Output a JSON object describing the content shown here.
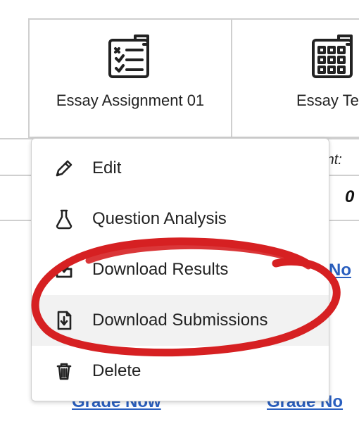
{
  "columns": [
    {
      "title": "Essay Assignment 01",
      "icon": "checklist-icon"
    },
    {
      "title": "Essay Test",
      "icon": "grid-sheet-icon"
    }
  ],
  "row_info": {
    "points_fragment": "oint:",
    "zero_value": "0"
  },
  "links": {
    "partial_right": "e No",
    "bottom_left": "Grade Now",
    "bottom_right": "Grade No"
  },
  "menu": {
    "items": [
      {
        "id": "edit",
        "label": "Edit",
        "icon": "pencil-icon",
        "highlight": false
      },
      {
        "id": "qanalysis",
        "label": "Question Analysis",
        "icon": "flask-icon",
        "highlight": false
      },
      {
        "id": "dlresults",
        "label": "Download Results",
        "icon": "download-box-icon",
        "highlight": false
      },
      {
        "id": "dlsubs",
        "label": "Download Submissions",
        "icon": "download-page-icon",
        "highlight": true
      },
      {
        "id": "delete",
        "label": "Delete",
        "icon": "trash-icon",
        "highlight": false
      }
    ]
  },
  "annotation": {
    "color": "#d62022",
    "target_menu_item": "dlsubs"
  }
}
